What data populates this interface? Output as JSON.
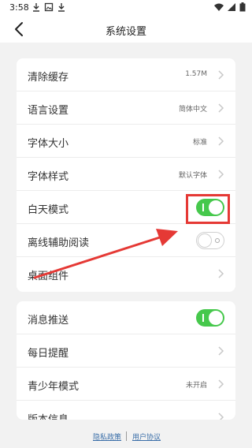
{
  "status_bar": {
    "time": "3:58",
    "left_icons": [
      "download-icon",
      "photo-icon",
      "download-icon"
    ],
    "right_icons": [
      "wifi-icon",
      "signal-icon",
      "battery-icon"
    ]
  },
  "header": {
    "title": "系统设置",
    "back_icon": "chevron-left-icon"
  },
  "settings_group_1": [
    {
      "label": "清除缓存",
      "value": "1.57M",
      "control": "chevron"
    },
    {
      "label": "语言设置",
      "value": "简体中文",
      "control": "chevron"
    },
    {
      "label": "字体大小",
      "value": "标准",
      "control": "chevron"
    },
    {
      "label": "字体样式",
      "value": "默认字体",
      "control": "chevron"
    },
    {
      "label": "白天模式",
      "control": "toggle",
      "state": "on"
    },
    {
      "label": "离线辅助阅读",
      "control": "toggle",
      "state": "off"
    },
    {
      "label": "桌面组件",
      "control": "chevron"
    }
  ],
  "settings_group_2": [
    {
      "label": "消息推送",
      "control": "toggle",
      "state": "on"
    },
    {
      "label": "每日提醒",
      "control": "chevron"
    },
    {
      "label": "青少年模式",
      "value": "未开启",
      "control": "chevron"
    },
    {
      "label": "版本信息",
      "control": "chevron"
    }
  ],
  "footer": {
    "privacy": "隐私政策",
    "agreement": "用户协议"
  },
  "colors": {
    "accent_green": "#46c84c",
    "annotation_red": "#e53935",
    "link_blue": "#3a6ea8"
  }
}
